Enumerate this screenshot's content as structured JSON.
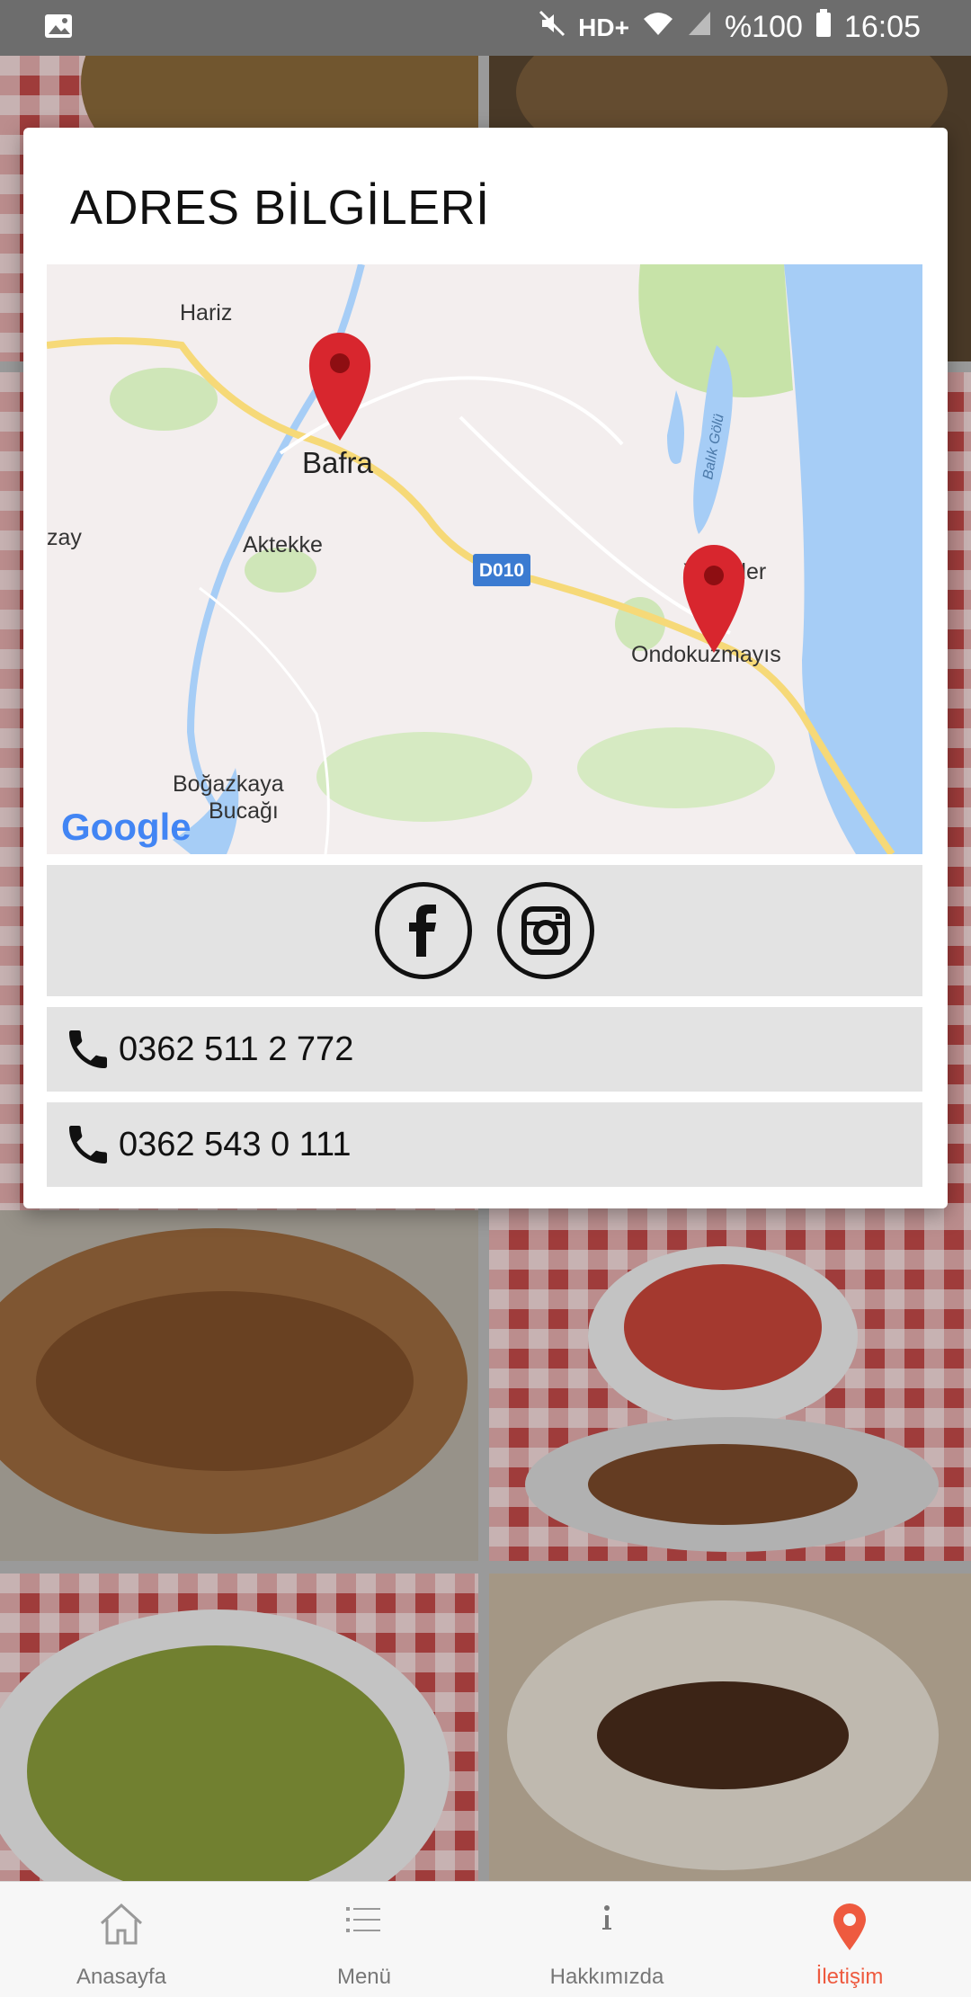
{
  "status_bar": {
    "network": "HD+",
    "battery": "%100",
    "time": "16:05",
    "icons": [
      "image-icon",
      "mute-icon",
      "wifi-icon",
      "signal-icon",
      "battery-icon"
    ]
  },
  "modal": {
    "title": "ADRES BİLGİLERİ",
    "map": {
      "labels": {
        "hariz": "Hariz",
        "bafra": "Bafra",
        "aktekke": "Aktekke",
        "zay": "zay",
        "road": "D010",
        "yeniler": "Yeşilkler",
        "ondokuzmayis": "Ondokuzmayıs",
        "balik_golu": "Balık Gölü",
        "bogazkaya": "Boğazkaya",
        "bucagi": "Bucağı",
        "google": "Google"
      }
    },
    "social": {
      "facebook": "facebook-icon",
      "instagram": "instagram-icon"
    },
    "phones": [
      "0362 511 2 772",
      "0362 543 0 111"
    ]
  },
  "bottom_nav": {
    "items": [
      {
        "label": "Anasayfa",
        "icon": "home-icon"
      },
      {
        "label": "Menü",
        "icon": "list-icon"
      },
      {
        "label": "Hakkımızda",
        "icon": "info-icon"
      },
      {
        "label": "İletişim",
        "icon": "location-pin-icon",
        "active": true
      }
    ],
    "active_color": "#ee5a3f"
  }
}
